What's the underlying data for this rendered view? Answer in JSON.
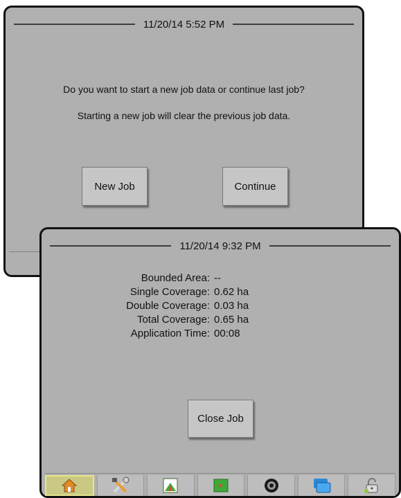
{
  "back_dialog": {
    "datetime": "11/20/14 5:52 PM",
    "message_line1": "Do you want to start a new job data or continue last job?",
    "message_line2": "Starting a new job will clear the previous job data.",
    "new_job_label": "New Job",
    "continue_label": "Continue"
  },
  "front_dialog": {
    "datetime": "11/20/14 9:32 PM",
    "stats": [
      {
        "label": "Bounded Area:",
        "value": "--"
      },
      {
        "label": "Single Coverage:",
        "value": "0.62 ha"
      },
      {
        "label": "Double Coverage:",
        "value": "0.03 ha"
      },
      {
        "label": "Total Coverage:",
        "value": "0.65 ha"
      },
      {
        "label": "Application Time:",
        "value": "00:08"
      }
    ],
    "close_job_label": "Close Job"
  },
  "nav_tabs": [
    {
      "icon": "home-icon",
      "active": true
    },
    {
      "icon": "tools-icon",
      "active": false
    },
    {
      "icon": "vehicle-view-icon",
      "active": false
    },
    {
      "icon": "field-view-icon",
      "active": false
    },
    {
      "icon": "real-view-camera-icon",
      "active": false
    },
    {
      "icon": "data-management-icon",
      "active": false
    },
    {
      "icon": "unlock-icon",
      "active": false
    }
  ],
  "colors": {
    "panel_bg": "#b0b0b0",
    "button_bg": "#c6c6c6",
    "active_tab_border": "#e6e68c"
  }
}
